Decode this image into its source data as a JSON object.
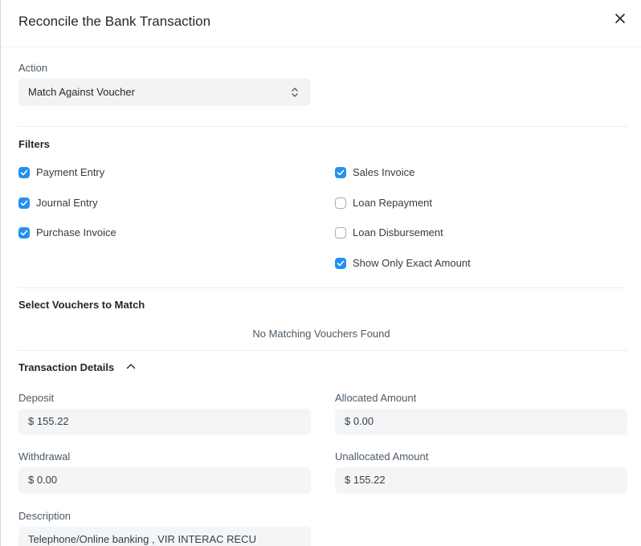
{
  "dialog": {
    "title": "Reconcile the Bank Transaction",
    "close_icon": "close-icon"
  },
  "action": {
    "label": "Action",
    "value": "Match Against Voucher",
    "icon": "select-arrows-icon"
  },
  "filters": {
    "title": "Filters",
    "left": [
      {
        "label": "Payment Entry",
        "checked": true
      },
      {
        "label": "Journal Entry",
        "checked": true
      },
      {
        "label": "Purchase Invoice",
        "checked": true
      }
    ],
    "right": [
      {
        "label": "Sales Invoice",
        "checked": true
      },
      {
        "label": "Loan Repayment",
        "checked": false
      },
      {
        "label": "Loan Disbursement",
        "checked": false
      },
      {
        "label": "Show Only Exact Amount",
        "checked": true
      }
    ]
  },
  "vouchers": {
    "title": "Select Vouchers to Match",
    "empty_message": "No Matching Vouchers Found"
  },
  "transaction": {
    "title": "Transaction Details",
    "collapse_icon": "chevron-up-icon",
    "deposit_label": "Deposit",
    "deposit_value": "$ 155.22",
    "allocated_label": "Allocated Amount",
    "allocated_value": "$ 0.00",
    "withdrawal_label": "Withdrawal",
    "withdrawal_value": "$ 0.00",
    "unallocated_label": "Unallocated Amount",
    "unallocated_value": "$ 155.22",
    "description_label": "Description",
    "description_value": "Telephone/Online banking , VIR INTERAC RECU"
  },
  "colors": {
    "accent": "#2490ef",
    "field_bg": "#f4f5f6"
  }
}
